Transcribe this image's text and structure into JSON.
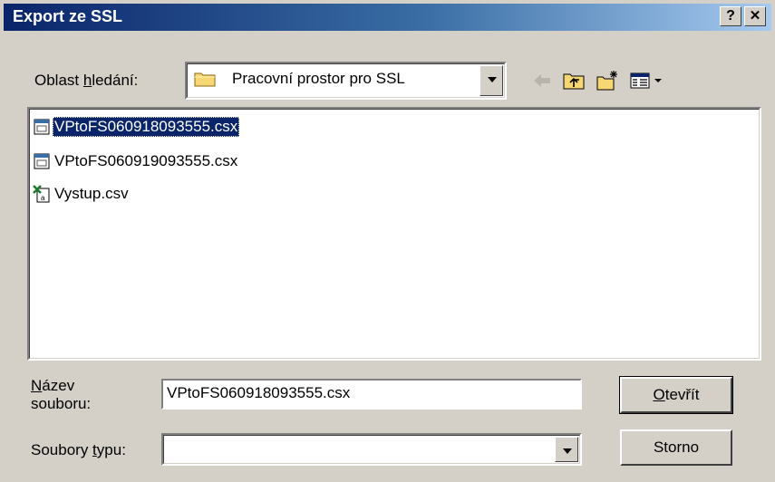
{
  "window": {
    "title": "Export ze SSL",
    "help_button": "?",
    "close_button": "✕"
  },
  "lookin": {
    "label_pre": "Oblast ",
    "label_accel": "h",
    "label_post": "ledání:",
    "selected": "Pracovní prostor pro SSL"
  },
  "toolbar": {
    "icons": [
      "back-icon",
      "up-folder-icon",
      "new-folder-icon",
      "view-menu-icon"
    ]
  },
  "files": [
    {
      "name": "VPtoFS060918093555.csx",
      "icon": "csx-file-icon",
      "selected": true
    },
    {
      "name": "VPtoFS060919093555.csx",
      "icon": "csx-file-icon",
      "selected": false
    },
    {
      "name": "Vystup.csv",
      "icon": "excel-csv-icon",
      "selected": false
    }
  ],
  "filename": {
    "label_accel": "N",
    "label_line1_rest": "ázev",
    "label_line2": "souboru:",
    "value": "VPtoFS060918093555.csx"
  },
  "filetype": {
    "label_pre": "Soubory ",
    "label_accel": "t",
    "label_post": "ypu:",
    "value": ""
  },
  "buttons": {
    "open_accel": "O",
    "open_rest": "tevřít",
    "cancel": "Storno"
  },
  "colors": {
    "title_start": "#0a246a",
    "title_end": "#a6caf0",
    "face": "#d4d0c8",
    "selection": "#0a246a"
  }
}
